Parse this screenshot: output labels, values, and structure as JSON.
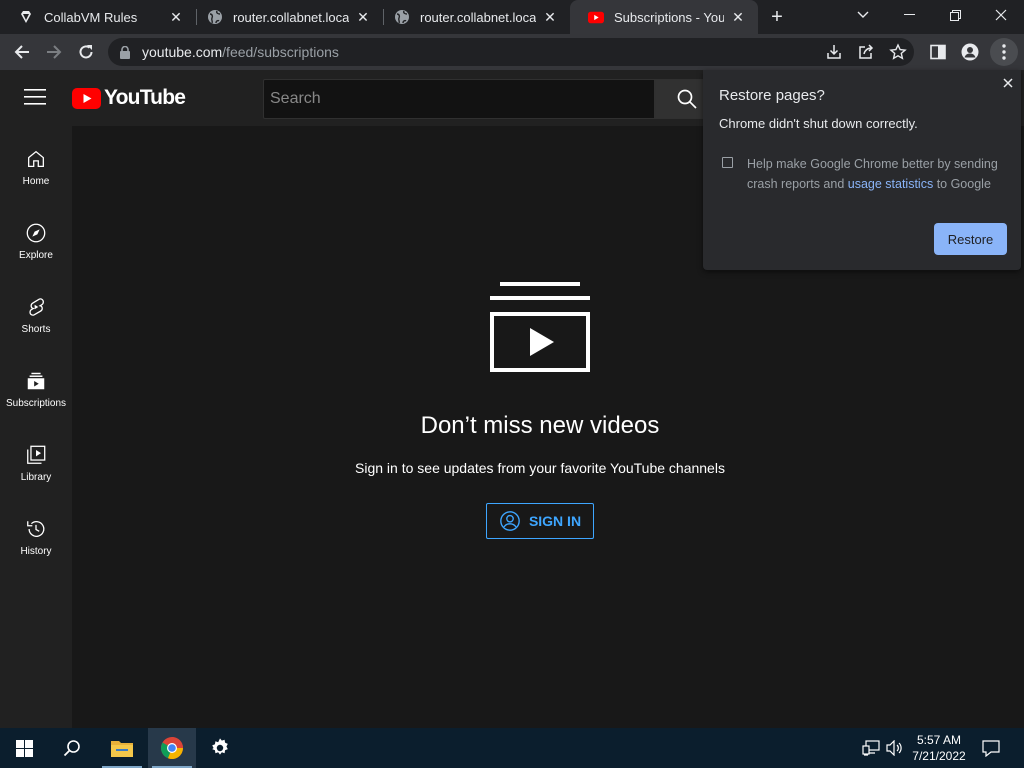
{
  "browser": {
    "tabs": [
      {
        "title": "CollabVM Rules",
        "active": false
      },
      {
        "title": "router.collabnet.local/t",
        "active": false
      },
      {
        "title": "router.collabnet.local/t",
        "active": false
      },
      {
        "title": "Subscriptions - YouTube",
        "active": true
      }
    ],
    "url_host": "youtube.com",
    "url_path": "/feed/subscriptions"
  },
  "youtube": {
    "logo_text": "YouTube",
    "search_placeholder": "Search",
    "sidebar": [
      {
        "label": "Home",
        "icon": "home-icon"
      },
      {
        "label": "Explore",
        "icon": "compass-icon"
      },
      {
        "label": "Shorts",
        "icon": "shorts-icon"
      },
      {
        "label": "Subscriptions",
        "icon": "subscriptions-icon"
      },
      {
        "label": "Library",
        "icon": "library-icon"
      },
      {
        "label": "History",
        "icon": "history-icon"
      }
    ],
    "main": {
      "heading": "Don’t miss new videos",
      "subtext": "Sign in to see updates from your favorite YouTube channels",
      "signin_label": "SIGN IN"
    }
  },
  "restore_dialog": {
    "title": "Restore pages?",
    "message": "Chrome didn't shut down correctly.",
    "checkbox_text_before": "Help make Google Chrome better by sending crash reports and ",
    "checkbox_link": "usage statistics",
    "checkbox_text_after": " to Google",
    "button_label": "Restore"
  },
  "taskbar": {
    "time": "5:57 AM",
    "date": "7/21/2022"
  },
  "colors": {
    "yt_red": "#ff0000",
    "accent_blue": "#3ea6ff",
    "chrome_blue": "#8ab4f8"
  }
}
